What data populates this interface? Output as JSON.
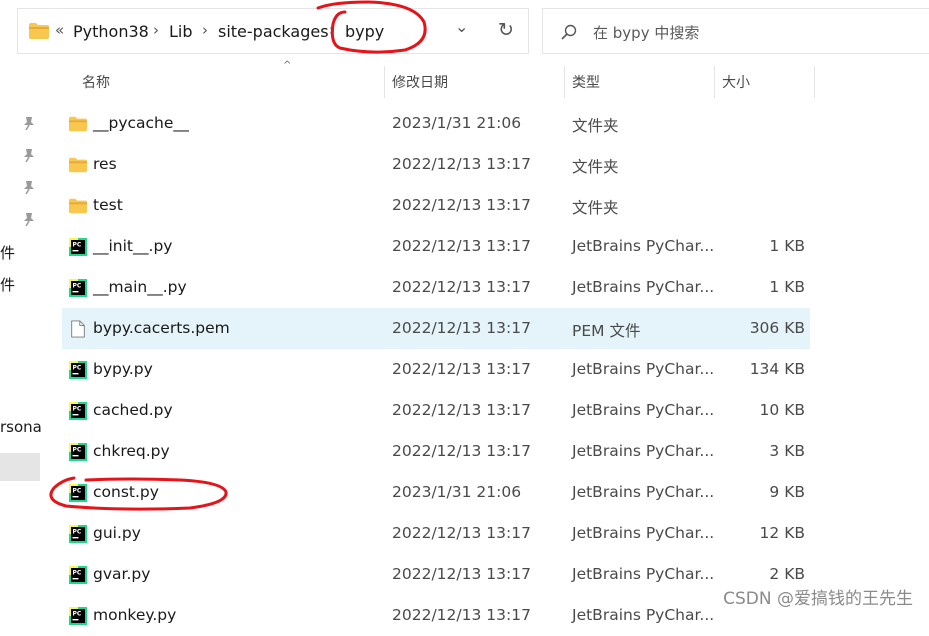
{
  "address_bar": {
    "overflow_glyph": "«",
    "crumbs": [
      "Python38",
      "Lib",
      "site-packages",
      "bypy"
    ],
    "separator": "›",
    "history_glyph": "⌄",
    "refresh_glyph": "↻"
  },
  "search": {
    "placeholder": "在 bypy 中搜索"
  },
  "left_pane": {
    "fragments": [
      "件",
      "件",
      "rsona"
    ]
  },
  "columns": {
    "sort_glyph": "^",
    "name": "名称",
    "date": "修改日期",
    "type": "类型",
    "size": "大小"
  },
  "files": [
    {
      "name": "__pycache__",
      "date": "2023/1/31 21:06",
      "type": "文件夹",
      "size": "",
      "icon": "folder-icon"
    },
    {
      "name": "res",
      "date": "2022/12/13 13:17",
      "type": "文件夹",
      "size": "",
      "icon": "folder-icon"
    },
    {
      "name": "test",
      "date": "2022/12/13 13:17",
      "type": "文件夹",
      "size": "",
      "icon": "folder-icon"
    },
    {
      "name": "__init__.py",
      "date": "2022/12/13 13:17",
      "type": "JetBrains PyChar...",
      "size": "1 KB",
      "icon": "pycharm-file-icon"
    },
    {
      "name": "__main__.py",
      "date": "2022/12/13 13:17",
      "type": "JetBrains PyChar...",
      "size": "1 KB",
      "icon": "pycharm-file-icon"
    },
    {
      "name": "bypy.cacerts.pem",
      "date": "2022/12/13 13:17",
      "type": "PEM 文件",
      "size": "306 KB",
      "icon": "document-icon"
    },
    {
      "name": "bypy.py",
      "date": "2022/12/13 13:17",
      "type": "JetBrains PyChar...",
      "size": "134 KB",
      "icon": "pycharm-file-icon"
    },
    {
      "name": "cached.py",
      "date": "2022/12/13 13:17",
      "type": "JetBrains PyChar...",
      "size": "10 KB",
      "icon": "pycharm-file-icon"
    },
    {
      "name": "chkreq.py",
      "date": "2022/12/13 13:17",
      "type": "JetBrains PyChar...",
      "size": "3 KB",
      "icon": "pycharm-file-icon"
    },
    {
      "name": "const.py",
      "date": "2023/1/31 21:06",
      "type": "JetBrains PyChar...",
      "size": "9 KB",
      "icon": "pycharm-file-icon"
    },
    {
      "name": "gui.py",
      "date": "2022/12/13 13:17",
      "type": "JetBrains PyChar...",
      "size": "12 KB",
      "icon": "pycharm-file-icon"
    },
    {
      "name": "gvar.py",
      "date": "2022/12/13 13:17",
      "type": "JetBrains PyChar...",
      "size": "2 KB",
      "icon": "pycharm-file-icon"
    },
    {
      "name": "monkey.py",
      "date": "2022/12/13 13:17",
      "type": "JetBrains PyChar...",
      "size": "",
      "icon": "pycharm-file-icon"
    }
  ],
  "highlighted_index": 5,
  "watermark": "CSDN @爱搞钱的王先生",
  "colors": {
    "accent_highlight": "#e5f3fb",
    "annotation_red": "#e4141b",
    "folder_yellow": "#f8c74e",
    "pycharm_green": "#21d789"
  }
}
